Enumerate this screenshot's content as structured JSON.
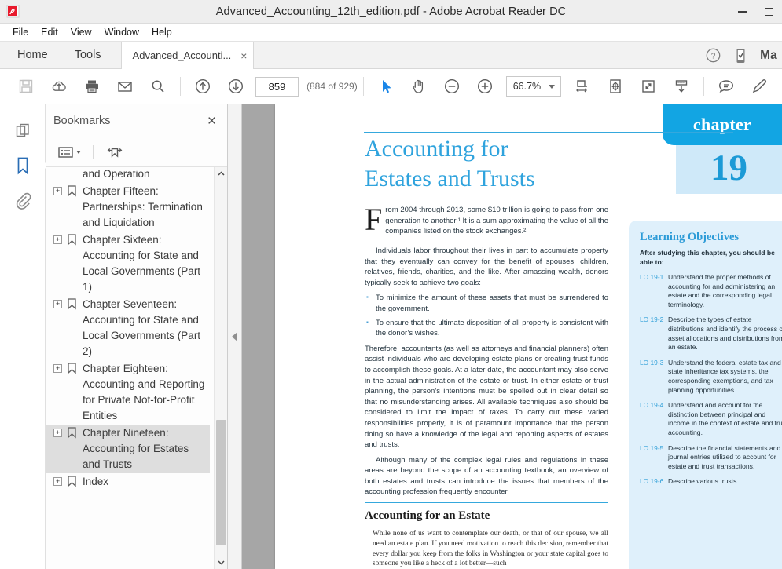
{
  "window": {
    "title": "Advanced_Accounting_12th_edition.pdf - Adobe Acrobat Reader DC",
    "minimize_label": "Minimize",
    "maximize_label": "Maximize"
  },
  "menubar": {
    "items": [
      {
        "label": "File"
      },
      {
        "label": "Edit"
      },
      {
        "label": "View"
      },
      {
        "label": "Window"
      },
      {
        "label": "Help"
      }
    ]
  },
  "tabstrip": {
    "home_label": "Home",
    "tools_label": "Tools",
    "document_tab_label": "Advanced_Accounti...",
    "close_glyph": "×",
    "help_icon": "question-circle-icon",
    "mobile_icon": "mobile-link-icon",
    "signin_label": "Ma"
  },
  "toolbar": {
    "save_title": "Save File",
    "upload_title": "Save to Cloud",
    "print_title": "Print File",
    "email_title": "Email File",
    "search_title": "Find",
    "prev_page_title": "Previous Page",
    "next_page_title": "Next Page",
    "page_number": "859",
    "page_count": "(884 of 929)",
    "select_tool_title": "Select Tool",
    "hand_tool_title": "Hand Tool",
    "zoom_out_title": "Zoom Out",
    "zoom_in_title": "Zoom In",
    "zoom_level": "66.7%",
    "fit_width_title": "Fit Width",
    "fit_page_title": "Fit Page",
    "fullscreen_title": "Read Mode",
    "scroll_down_title": "Scroll Down",
    "comment_title": "Comment",
    "highlight_title": "Highlight Text"
  },
  "rail": {
    "page_thumbnails_label": "Page Thumbnails",
    "bookmarks_label": "Bookmarks",
    "attachments_label": "Attachments",
    "active": "bookmarks",
    "accent_color": "#2a6db5"
  },
  "bookmarks_panel": {
    "title": "Bookmarks",
    "close_glyph": "×",
    "options_icon": "list-options-icon",
    "new_bookmark_icon": "new-bookmark-icon",
    "scroll_up_glyph": "ⱏ",
    "scroll_down_glyph": "ⱟ",
    "items": [
      {
        "label": "Partnerships: Formation and Operation",
        "expandable": false,
        "selected": false
      },
      {
        "label": "Chapter Fifteen: Partnerships: Termination and Liquidation",
        "expandable": true,
        "selected": false
      },
      {
        "label": "Chapter Sixteen: Accounting for State and Local Governments (Part 1)",
        "expandable": true,
        "selected": false
      },
      {
        "label": "Chapter Seventeen: Accounting for State and Local Governments (Part 2)",
        "expandable": true,
        "selected": false
      },
      {
        "label": "Chapter Eighteen: Accounting and Reporting for Private Not-for-Profit Entities",
        "expandable": true,
        "selected": false
      },
      {
        "label": "Chapter Nineteen: Accounting for Estates and Trusts",
        "expandable": true,
        "selected": true
      },
      {
        "label": "Index",
        "expandable": true,
        "selected": false
      }
    ],
    "expander_glyph": "+"
  },
  "document": {
    "chapter_word": "chapter",
    "chapter_number": "19",
    "title_line1": "Accounting for",
    "title_line2": "Estates and Trusts",
    "accent_color": "#2fa3dd",
    "dropcap": "F",
    "intro_paragraph": "rom 2004 through 2013, some $10 trillion is going to pass from one generation to another.¹ It is a sum approximating the value of all the companies listed on the stock exchanges.²",
    "paragraph_2": "Individuals labor throughout their lives in part to accumulate property that they eventually can convey for the benefit of spouses, children, relatives, friends, charities, and the like. After amassing wealth, donors typically seek to achieve two goals:",
    "bullets": [
      "To minimize the amount of these assets that must be surrendered to the government.",
      "To ensure that the ultimate disposition of all property is consistent with the donor’s wishes."
    ],
    "paragraph_3": "Therefore, accountants (as well as attorneys and financial planners) often assist individuals who are developing estate plans or creating trust funds to accomplish these goals. At a later date, the accountant may also serve in the actual administration of the estate or trust. In either estate or trust planning, the person’s intentions must be spelled out in clear detail so that no misunderstanding arises. All available techniques also should be considered to limit the impact of taxes. To carry out these varied responsibilities properly, it is of paramount importance that the person doing so have a knowledge of the legal and reporting aspects of estates and trusts.",
    "paragraph_4": "Although many of the complex legal rules and regulations in these areas are beyond the scope of an accounting textbook, an overview of both estates and trusts can introduce the issues that members of the accounting profession frequently encounter.",
    "section_heading": "Accounting for an Estate",
    "section_body": "While none of us want to contemplate our death, or that of our spouse, we all need an estate plan. If you need motivation to reach this decision, remember that every dollar you keep from the folks in Washington or your state capital goes to someone you like a heck of a lot better—such",
    "learning_objectives": {
      "title": "Learning Objectives",
      "subtitle": "After studying this chapter, you should be able to:",
      "items": [
        {
          "code": "LO 19-1",
          "text": "Understand the proper methods of accounting for and administering an estate and the corresponding legal terminology."
        },
        {
          "code": "LO 19-2",
          "text": "Describe the types of estate distributions and identify the process of asset allocations and distributions from an estate."
        },
        {
          "code": "LO 19-3",
          "text": "Understand the federal estate tax and state inheritance tax systems, the corresponding exemptions, and tax planning opportunities."
        },
        {
          "code": "LO 19-4",
          "text": "Understand and account for the distinction between principal and income in the context of estate and trust accounting."
        },
        {
          "code": "LO 19-5",
          "text": "Describe the financial statements and journal entries utilized to account for estate and trust transactions."
        },
        {
          "code": "LO 19-6",
          "text": "Describe various trusts"
        }
      ]
    }
  }
}
